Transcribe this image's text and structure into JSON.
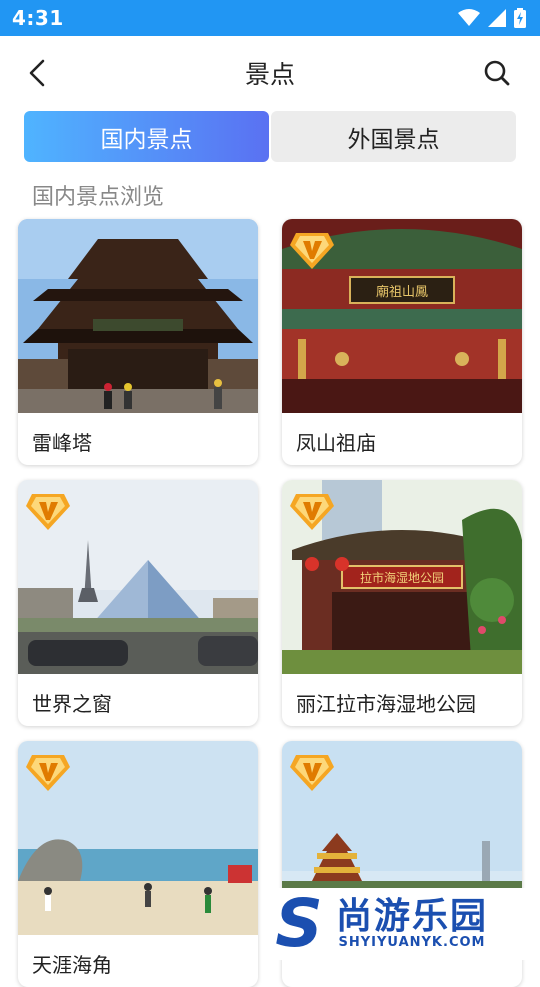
{
  "status_bar": {
    "time": "4:31"
  },
  "header": {
    "title": "景点"
  },
  "tabs": [
    {
      "label": "国内景点",
      "active": true
    },
    {
      "label": "外国景点",
      "active": false
    }
  ],
  "section_title": "国内景点浏览",
  "spots": [
    {
      "name": "雷峰塔",
      "vip": false
    },
    {
      "name": "凤山祖庙",
      "vip": true
    },
    {
      "name": "世界之窗",
      "vip": true
    },
    {
      "name": "丽江拉市海湿地公园",
      "vip": true
    },
    {
      "name": "天涯海角",
      "vip": true
    },
    {
      "name": "",
      "vip": true
    }
  ],
  "image_signs": {
    "temple_sign": "廟祖山鳳",
    "park_sign": "拉市海湿地公园"
  },
  "watermark": {
    "glyph": "S",
    "cn": "尚游乐园",
    "en": "SHYIYUANYK.COM"
  },
  "colors": {
    "status_bar": "#2196F3",
    "tab_gradient_start": "#4fb4ff",
    "tab_gradient_end": "#5a71f2",
    "badge_orange": "#f5a623",
    "watermark_blue": "#1b4fb0"
  }
}
